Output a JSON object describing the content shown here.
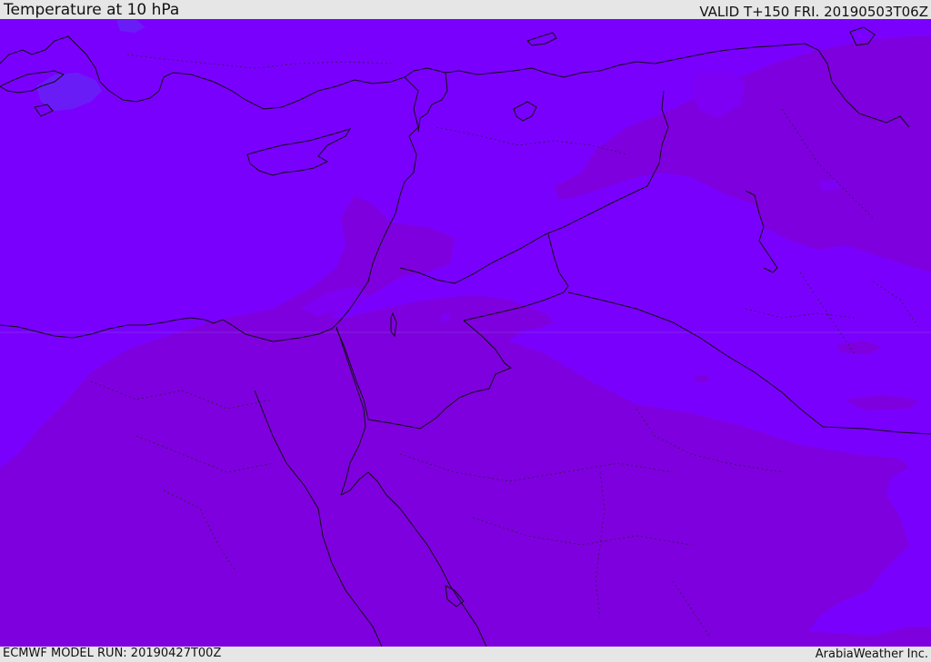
{
  "header": {
    "title": "Temperature at 10 hPa",
    "valid": "VALID T+150 FRI. 20190503T06Z"
  },
  "footer": {
    "model_run": "ECMWF MODEL RUN: 20190427T00Z",
    "brand": "ArabiaWeather Inc."
  },
  "map": {
    "colors": {
      "field_base": "#7a00fe",
      "field_warm": "#7e00de",
      "field_cool": "#6a1cf7",
      "boundary": "#111111"
    }
  }
}
